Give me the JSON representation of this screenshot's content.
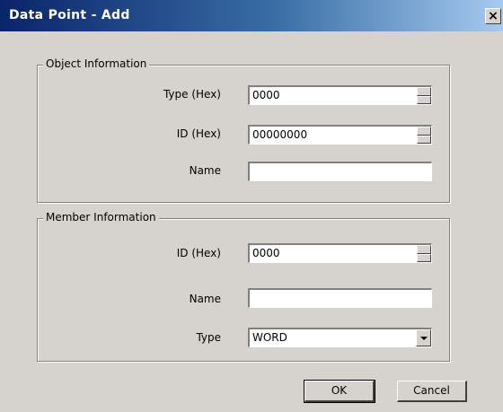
{
  "window": {
    "title": "Data Point - Add",
    "close_glyph": "×"
  },
  "object_group": {
    "label": "Object Information",
    "type_label": "Type (Hex)",
    "type_value": "0000",
    "id_label": "ID (Hex)",
    "id_value": "00000000",
    "name_label": "Name",
    "name_value": ""
  },
  "member_group": {
    "label": "Member Information",
    "id_label": "ID (Hex)",
    "id_value": "0000",
    "name_label": "Name",
    "name_value": "",
    "type_label": "Type",
    "type_value": "WORD"
  },
  "buttons": {
    "ok": "OK",
    "cancel": "Cancel"
  }
}
